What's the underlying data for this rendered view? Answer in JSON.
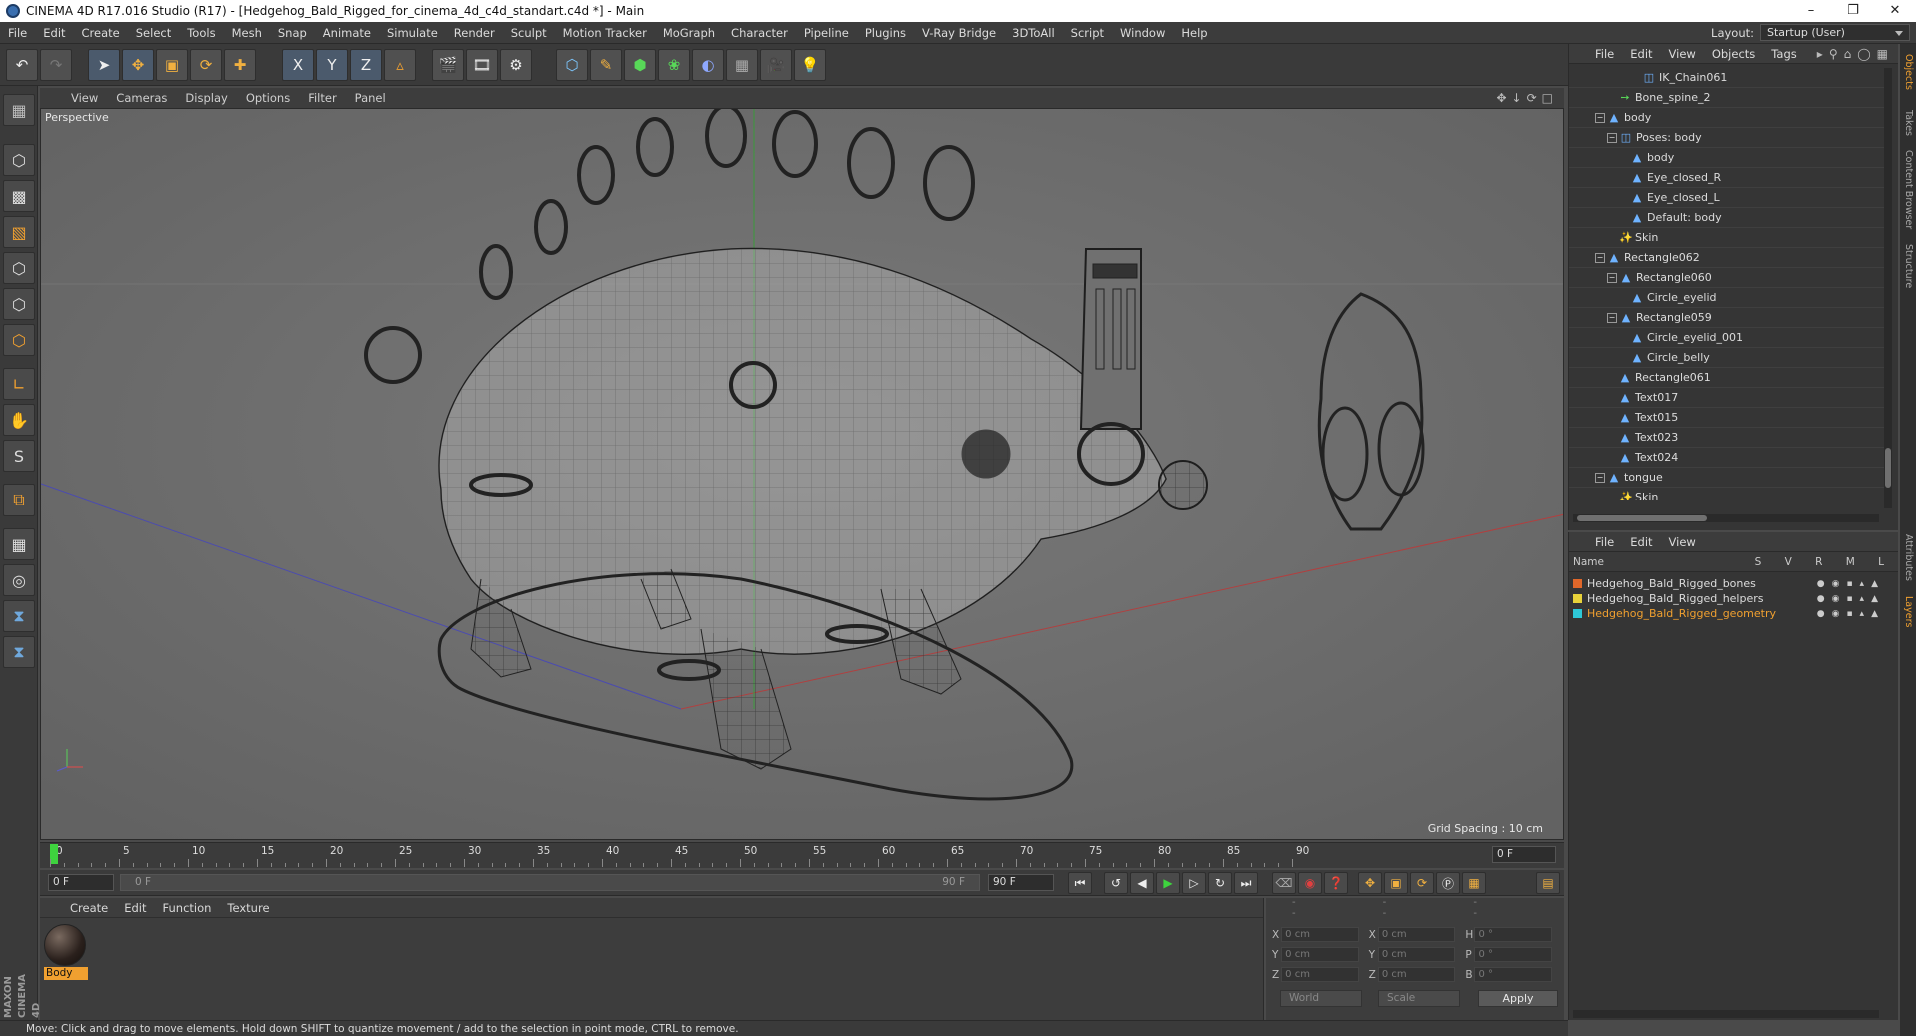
{
  "window": {
    "title": "CINEMA 4D R17.016 Studio (R17) - [Hedgehog_Bald_Rigged_for_cinema_4d_c4d_standart.c4d *] - Main"
  },
  "menu": [
    "File",
    "Edit",
    "Create",
    "Select",
    "Tools",
    "Mesh",
    "Snap",
    "Animate",
    "Simulate",
    "Render",
    "Sculpt",
    "Motion Tracker",
    "MoGraph",
    "Character",
    "Pipeline",
    "Plugins",
    "V-Ray Bridge",
    "3DToAll",
    "Script",
    "Window",
    "Help"
  ],
  "layout": {
    "label": "Layout:",
    "value": "Startup (User)"
  },
  "toolbar": {
    "x": "X",
    "y": "Y",
    "z": "Z"
  },
  "viewport": {
    "menu": [
      "View",
      "Cameras",
      "Display",
      "Options",
      "Filter",
      "Panel"
    ],
    "camera": "Perspective",
    "grid_spacing": "Grid Spacing : 10 cm"
  },
  "timeline": {
    "ticks": [
      "0",
      "5",
      "10",
      "15",
      "20",
      "25",
      "30",
      "35",
      "40",
      "45",
      "50",
      "55",
      "60",
      "65",
      "70",
      "75",
      "80",
      "85",
      "90"
    ],
    "current": "0 F",
    "start": "0 F",
    "range_start": "0 F",
    "range_end": "90 F",
    "end": "90 F"
  },
  "materials": {
    "menu": [
      "Create",
      "Edit",
      "Function",
      "Texture"
    ],
    "items": [
      {
        "name": "Body"
      }
    ]
  },
  "coords": {
    "header": [
      "--",
      "--",
      "--"
    ],
    "rows": [
      {
        "a": "X",
        "v1": "0 cm",
        "b": "X",
        "v2": "0 cm",
        "c": "H",
        "v3": "0 °"
      },
      {
        "a": "Y",
        "v1": "0 cm",
        "b": "Y",
        "v2": "0 cm",
        "c": "P",
        "v3": "0 °"
      },
      {
        "a": "Z",
        "v1": "0 cm",
        "b": "Z",
        "v2": "0 cm",
        "c": "B",
        "v3": "0 °"
      }
    ],
    "world": "World",
    "scale": "Scale",
    "apply": "Apply"
  },
  "objects": {
    "menu": [
      "File",
      "Edit",
      "View",
      "Objects",
      "Tags"
    ],
    "tree": [
      {
        "label": "IK_Chain061",
        "icon": "ik-chain-icon"
      },
      {
        "label": "Bone_spine_2",
        "icon": "bone-icon"
      },
      {
        "label": "body",
        "icon": "null-icon"
      },
      {
        "label": "Poses: body",
        "icon": "pose-icon"
      },
      {
        "label": "body",
        "icon": "polygon-icon"
      },
      {
        "label": "Eye_closed_R",
        "icon": "polygon-icon"
      },
      {
        "label": "Eye_closed_L",
        "icon": "polygon-icon"
      },
      {
        "label": "Default: body",
        "icon": "polygon-icon"
      },
      {
        "label": "Skin",
        "icon": "skin-icon"
      },
      {
        "label": "Rectangle062",
        "icon": "spline-icon"
      },
      {
        "label": "Rectangle060",
        "icon": "spline-icon"
      },
      {
        "label": "Circle_eyelid",
        "icon": "spline-icon"
      },
      {
        "label": "Rectangle059",
        "icon": "spline-icon"
      },
      {
        "label": "Circle_eyelid_001",
        "icon": "spline-icon"
      },
      {
        "label": "Circle_belly",
        "icon": "spline-icon"
      },
      {
        "label": "Rectangle061",
        "icon": "spline-icon"
      },
      {
        "label": "Text017",
        "icon": "spline-icon"
      },
      {
        "label": "Text015",
        "icon": "spline-icon"
      },
      {
        "label": "Text023",
        "icon": "spline-icon"
      },
      {
        "label": "Text024",
        "icon": "spline-icon"
      },
      {
        "label": "tongue",
        "icon": "null-icon"
      },
      {
        "label": "Skin",
        "icon": "skin-icon"
      }
    ]
  },
  "side_tabs": [
    "Objects",
    "Takes",
    "Content Browser",
    "Structure",
    "Attributes",
    "Layers"
  ],
  "layers": {
    "menu": [
      "File",
      "Edit",
      "View"
    ],
    "name_header": "Name",
    "cols": "S V R M L",
    "items": [
      {
        "name": "Hedgehog_Bald_Rigged_bones",
        "color": "#e0672a",
        "active": false
      },
      {
        "name": "Hedgehog_Bald_Rigged_helpers",
        "color": "#e8d23a",
        "active": false
      },
      {
        "name": "Hedgehog_Bald_Rigged_geometry",
        "color": "#2ec8d8",
        "active": true
      }
    ]
  },
  "status": "Move: Click and drag to move elements. Hold down SHIFT to quantize movement / add to the selection in point mode, CTRL to remove.",
  "brand": "MAXON CINEMA 4D"
}
